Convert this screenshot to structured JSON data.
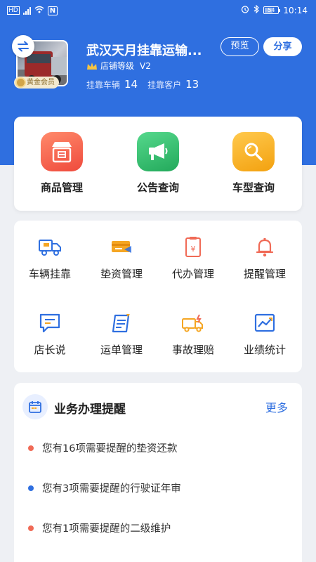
{
  "status_bar": {
    "time": "10:14",
    "battery": "54"
  },
  "shop": {
    "name": "武汉天月挂靠运输...",
    "level_label": "店铺等级",
    "level_value": "V2",
    "badge": "黄金会员",
    "stats": [
      {
        "label": "挂靠车辆",
        "value": "14"
      },
      {
        "label": "挂靠客户",
        "value": "13"
      }
    ],
    "preview_label": "预览",
    "share_label": "分享"
  },
  "main_actions": [
    {
      "label": "商品管理",
      "icon": "store-icon",
      "color": "#f05c45"
    },
    {
      "label": "公告查询",
      "icon": "megaphone-icon",
      "color": "#2fba6b"
    },
    {
      "label": "车型查询",
      "icon": "search-icon",
      "color": "#f5a623"
    }
  ],
  "grid_actions": [
    {
      "label": "车辆挂靠",
      "icon": "truck-icon"
    },
    {
      "label": "垫资管理",
      "icon": "card-icon"
    },
    {
      "label": "代办管理",
      "icon": "yuan-doc-icon"
    },
    {
      "label": "提醒管理",
      "icon": "bell-icon"
    },
    {
      "label": "店长说",
      "icon": "chat-icon"
    },
    {
      "label": "运单管理",
      "icon": "clipboard-icon"
    },
    {
      "label": "事故理赔",
      "icon": "accident-truck-icon"
    },
    {
      "label": "业绩统计",
      "icon": "chart-icon"
    }
  ],
  "reminders": {
    "title": "业务办理提醒",
    "more": "更多",
    "items": [
      {
        "text": "您有16项需要提醒的垫资还款",
        "dot_color": "#f06a56"
      },
      {
        "text": "您有3项需要提醒的行驶证年审",
        "dot_color": "#2f6fe0"
      },
      {
        "text": "您有1项需要提醒的二级维护",
        "dot_color": "#f06a56"
      }
    ]
  },
  "colors": {
    "brand": "#2f6fe0",
    "accent_orange": "#f5a623",
    "accent_red": "#f06a56"
  }
}
